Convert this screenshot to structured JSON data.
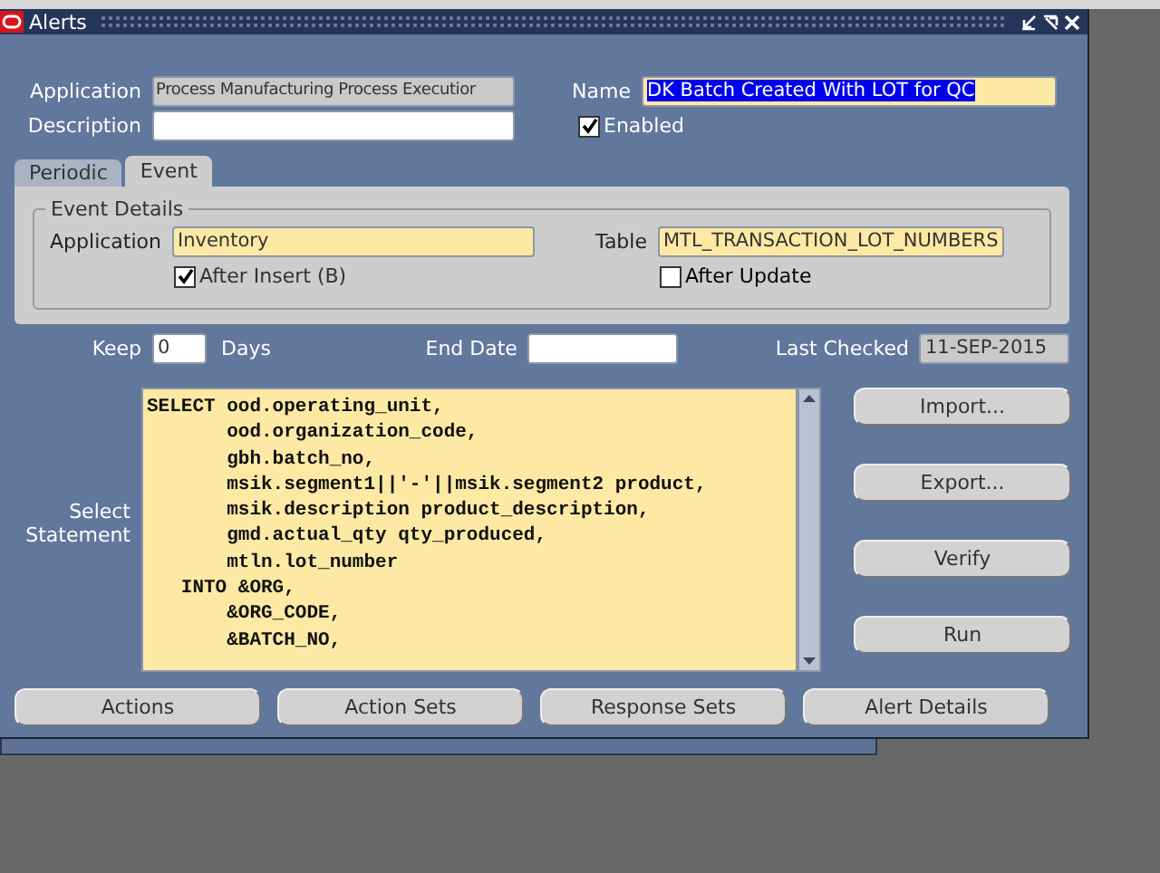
{
  "window": {
    "title": "Alerts"
  },
  "header": {
    "application_label": "Application",
    "application_value": "Process Manufacturing Process Executior",
    "name_label": "Name",
    "name_value": "DK Batch Created With LOT for QC",
    "description_label": "Description",
    "enabled": {
      "label": "Enabled",
      "checked": true
    }
  },
  "tabs": [
    {
      "label": "Periodic",
      "selected": false
    },
    {
      "label": "Event",
      "selected": true
    }
  ],
  "event_details": {
    "title": "Event Details",
    "application_label": "Application",
    "application_value": "Inventory",
    "table_label": "Table",
    "table_value": "MTL_TRANSACTION_LOT_NUMBERS",
    "after_insert": {
      "label": "After Insert (B)",
      "checked": true
    },
    "after_update": {
      "label": "After Update",
      "checked": false
    }
  },
  "keep": {
    "label": "Keep",
    "value": "0",
    "unit": "Days"
  },
  "end_date": {
    "label": "End Date"
  },
  "last_checked": {
    "label": "Last Checked",
    "value": "11-SEP-2015"
  },
  "select_statement": {
    "label": "Select Statement",
    "lines": [
      "SELECT ood.operating_unit,",
      "       ood.organization_code,",
      "       gbh.batch_no,",
      "       msik.segment1||'-'||msik.segment2 product,",
      "       msik.description product_description,",
      "       gmd.actual_qty qty_produced,",
      "       mtln.lot_number",
      "   INTO &ORG,",
      "       &ORG_CODE,",
      "       &BATCH_NO,"
    ]
  },
  "side_buttons": [
    "Import...",
    "Export...",
    "Verify",
    "Run"
  ],
  "bottom_buttons": [
    "Actions",
    "Action Sets",
    "Response Sets",
    "Alert Details"
  ]
}
